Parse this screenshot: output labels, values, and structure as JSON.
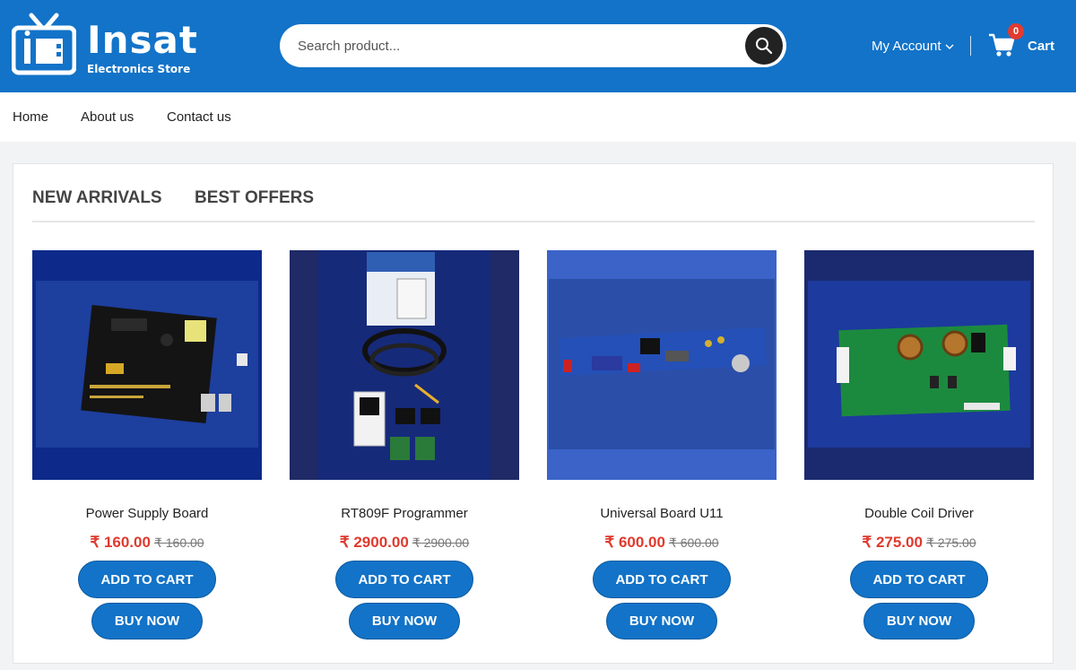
{
  "header": {
    "brand_name": "Insat",
    "brand_tagline": "Electronics Store",
    "search_placeholder": "Search product...",
    "account_label": "My Account",
    "cart_count": "0",
    "cart_label": "Cart"
  },
  "nav": {
    "items": [
      {
        "label": "Home"
      },
      {
        "label": "About us"
      },
      {
        "label": "Contact us"
      }
    ]
  },
  "tabs": [
    {
      "label": "NEW ARRIVALS"
    },
    {
      "label": "BEST OFFERS"
    }
  ],
  "products": [
    {
      "name": "Power Supply Board",
      "price": "₹ 160.00",
      "old_price": "₹ 160.00",
      "add_label": "ADD TO CART",
      "buy_label": "BUY NOW"
    },
    {
      "name": "RT809F Programmer",
      "price": "₹ 2900.00",
      "old_price": "₹ 2900.00",
      "add_label": "ADD TO CART",
      "buy_label": "BUY NOW"
    },
    {
      "name": "Universal Board U11",
      "price": "₹ 600.00",
      "old_price": "₹ 600.00",
      "add_label": "ADD TO CART",
      "buy_label": "BUY NOW"
    },
    {
      "name": "Double Coil Driver",
      "price": "₹ 275.00",
      "old_price": "₹ 275.00",
      "add_label": "ADD TO CART",
      "buy_label": "BUY NOW"
    }
  ],
  "colors": {
    "primary": "#1273c8",
    "price": "#e03a2e",
    "badge": "#e23b30"
  },
  "icons": {
    "logo": "tv-icon",
    "search": "search-icon",
    "account_dropdown": "chevron-down-icon",
    "cart": "cart-icon"
  }
}
